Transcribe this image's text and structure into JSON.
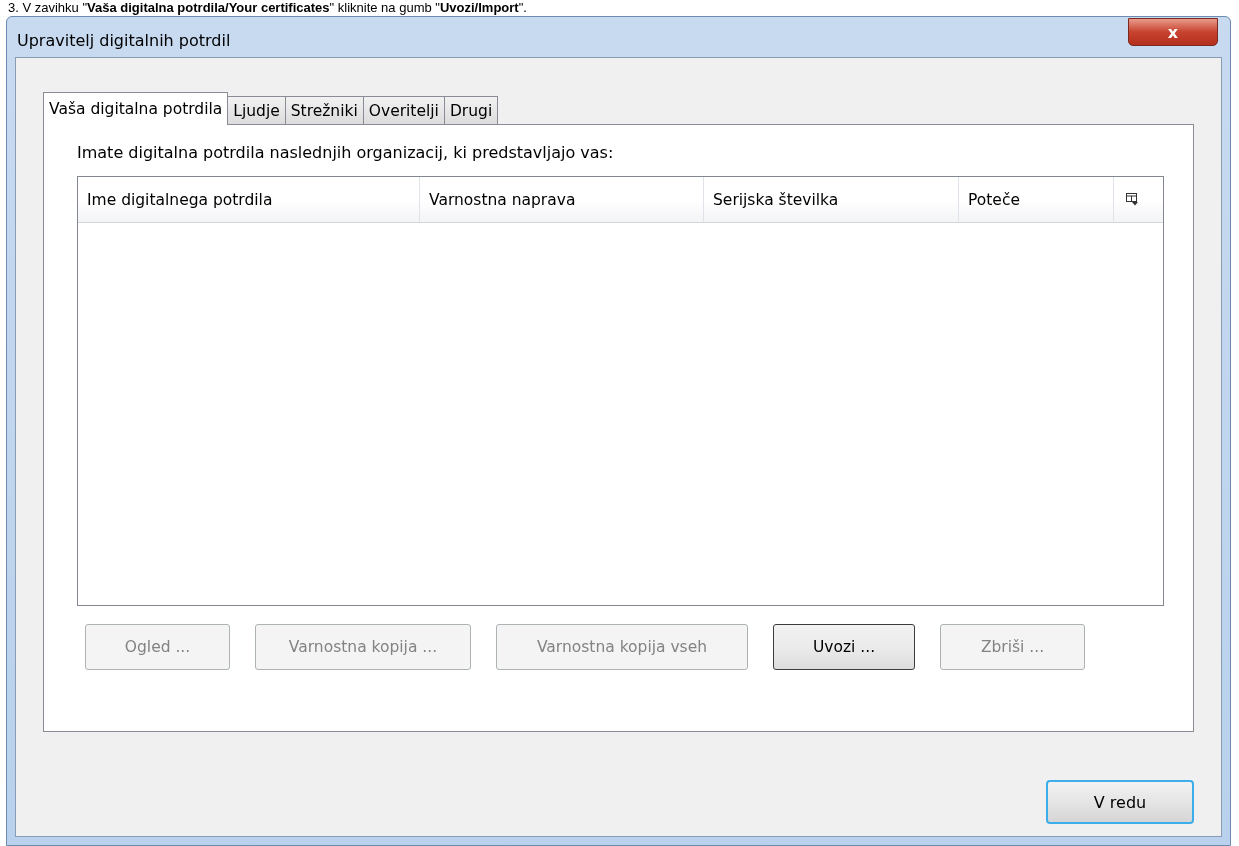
{
  "document_line": "3.   V zavihku \"**Vaša digitalna potrdila/Your certificates**\" kliknite na gumb \"**Uvozi/Import**\".",
  "window": {
    "title": "Upravitelj digitalnih potrdil",
    "close": "x"
  },
  "tabs": [
    {
      "label": "Vaša digitalna potrdila",
      "selected": true
    },
    {
      "label": "Ljudje",
      "selected": false
    },
    {
      "label": "Strežniki",
      "selected": false
    },
    {
      "label": "Overitelji",
      "selected": false
    },
    {
      "label": "Drugi",
      "selected": false
    }
  ],
  "intro": "Imate digitalna potrdila naslednjih organizacij, ki predstavljajo vas:",
  "table": {
    "columns": [
      "Ime digitalnega potrdila",
      "Varnostna naprava",
      "Serijska številka",
      "Poteče"
    ]
  },
  "buttons": [
    {
      "label": "Ogled ...",
      "disabled": true
    },
    {
      "label": "Varnostna kopija ...",
      "disabled": true
    },
    {
      "label": "Varnostna kopija vseh",
      "disabled": true
    },
    {
      "label": "Uvozi ...",
      "disabled": false
    },
    {
      "label": "Zbriši ...",
      "disabled": true
    }
  ],
  "ok_button": "V redu"
}
